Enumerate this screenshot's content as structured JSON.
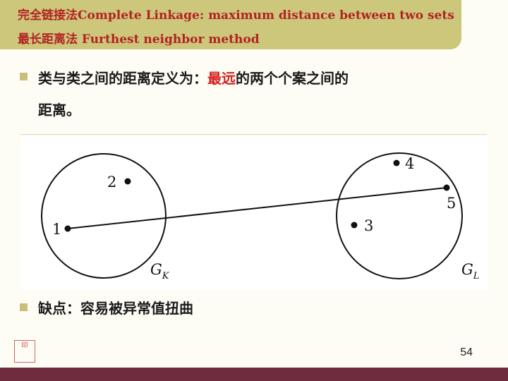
{
  "title": {
    "line1": "完全链接法Complete Linkage: maximum distance between two sets",
    "line2": "最长距离法 Furthest neighbor method"
  },
  "bullet1": {
    "text_a": "类与类之间的距离定义为：",
    "text_highlight": "最远",
    "text_b": "的两个个案之间的",
    "text_c": "距离。"
  },
  "diagram": {
    "points": [
      {
        "label": "1"
      },
      {
        "label": "2"
      },
      {
        "label": "3"
      },
      {
        "label": "4"
      },
      {
        "label": "5"
      }
    ],
    "cluster_left_label": "G",
    "cluster_left_sub": "K",
    "cluster_right_label": "G",
    "cluster_right_sub": "L"
  },
  "bullet2": {
    "text": "缺点：容易被异常值扭曲"
  },
  "page_number": "54",
  "logo_text": "印"
}
